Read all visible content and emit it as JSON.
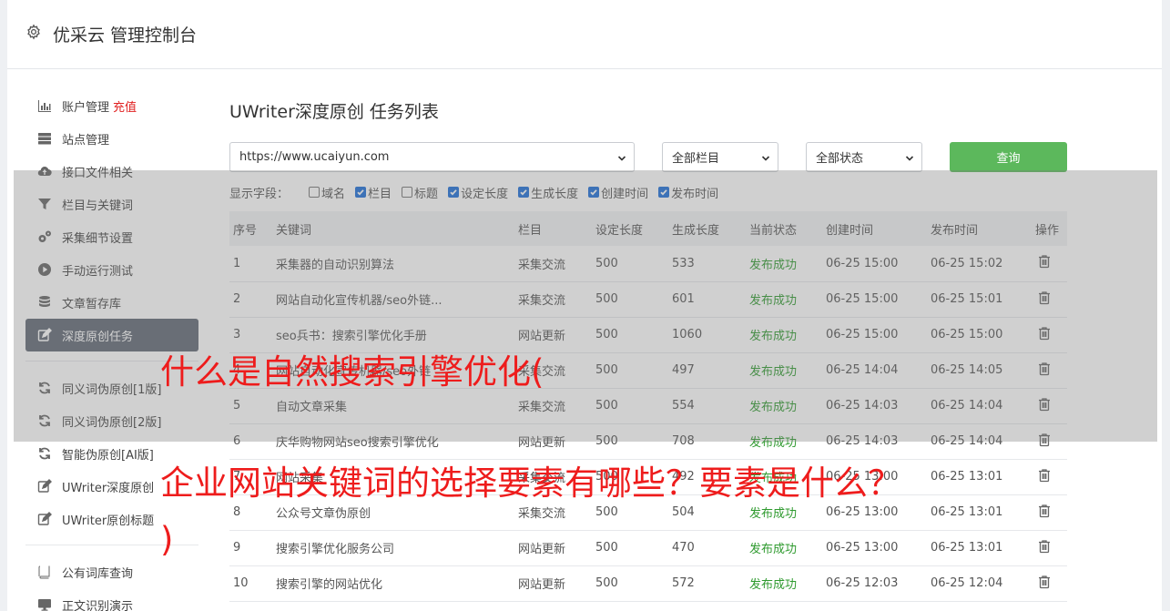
{
  "header": {
    "title": "优采云 管理控制台"
  },
  "sidebar": {
    "items": [
      {
        "label": "账户管理",
        "extra": "充值",
        "icon": "bar-chart-icon"
      },
      {
        "label": "站点管理",
        "icon": "server-icon"
      },
      {
        "label": "接口文件相关",
        "icon": "cloud-upload-icon"
      },
      {
        "label": "栏目与关键词",
        "icon": "filter-icon"
      },
      {
        "label": "采集细节设置",
        "icon": "gears-icon"
      },
      {
        "label": "手动运行测试",
        "icon": "play-circle-icon"
      },
      {
        "label": "文章暂存库",
        "icon": "database-icon"
      },
      {
        "label": "深度原创任务",
        "icon": "edit-icon",
        "active": true
      },
      {
        "label": "同义词伪原创[1版]",
        "icon": "refresh-icon"
      },
      {
        "label": "同义词伪原创[2版]",
        "icon": "refresh-icon"
      },
      {
        "label": "智能伪原创[AI版]",
        "icon": "refresh-icon"
      },
      {
        "label": "UWriter深度原创",
        "icon": "edit-icon"
      },
      {
        "label": "UWriter原创标题",
        "icon": "edit-icon"
      },
      {
        "label": "公有词库查询",
        "icon": "book-icon"
      },
      {
        "label": "正文识别演示",
        "icon": "monitor-icon"
      }
    ]
  },
  "main": {
    "title": "UWriter深度原创 任务列表",
    "site_select": "https://www.ucaiyun.com",
    "column_select": "全部栏目",
    "status_select": "全部状态",
    "query_label": "查询",
    "fields_label": "显示字段：",
    "fields": [
      {
        "label": "域名",
        "checked": false
      },
      {
        "label": "栏目",
        "checked": true
      },
      {
        "label": "标题",
        "checked": false
      },
      {
        "label": "设定长度",
        "checked": true
      },
      {
        "label": "生成长度",
        "checked": true
      },
      {
        "label": "创建时间",
        "checked": true
      },
      {
        "label": "发布时间",
        "checked": true
      }
    ],
    "table": {
      "headers": [
        "序号",
        "关键词",
        "栏目",
        "设定长度",
        "生成长度",
        "当前状态",
        "创建时间",
        "发布时间",
        "操作"
      ],
      "rows": [
        [
          "1",
          "采集器的自动识别算法",
          "采集交流",
          "500",
          "533",
          "发布成功",
          "06-25 15:00",
          "06-25 15:02"
        ],
        [
          "2",
          "网站自动化宣传机器/seo外链...",
          "采集交流",
          "500",
          "601",
          "发布成功",
          "06-25 15:00",
          "06-25 15:01"
        ],
        [
          "3",
          "seo兵书：搜索引擎优化手册",
          "网站更新",
          "500",
          "1060",
          "发布成功",
          "06-25 15:00",
          "06-25 15:00"
        ],
        [
          "4",
          "网站自动化宣传机器/seo外链",
          "采集交流",
          "500",
          "497",
          "发布成功",
          "06-25 14:04",
          "06-25 14:05"
        ],
        [
          "5",
          "自动文章采集",
          "采集交流",
          "500",
          "554",
          "发布成功",
          "06-25 14:03",
          "06-25 14:04"
        ],
        [
          "6",
          "庆华购物网站seo搜索引擎优化",
          "网站更新",
          "500",
          "708",
          "发布成功",
          "06-25 14:03",
          "06-25 14:04"
        ],
        [
          "7",
          "网站采集",
          "采集交流",
          "500",
          "492",
          "发布成功",
          "06-25 13:00",
          "06-25 13:01"
        ],
        [
          "8",
          "公众号文章伪原创",
          "采集交流",
          "500",
          "504",
          "发布成功",
          "06-25 13:00",
          "06-25 13:01"
        ],
        [
          "9",
          "搜索引擎优化服务公司",
          "网站更新",
          "500",
          "470",
          "发布成功",
          "06-25 13:00",
          "06-25 13:01"
        ],
        [
          "10",
          "搜索引擎的网站优化",
          "网站更新",
          "500",
          "572",
          "发布成功",
          "06-25 12:03",
          "06-25 12:04"
        ]
      ]
    }
  },
  "overlay": {
    "line1": "什么是自然搜索引擎优化(",
    "line2": "企业网站关键词的选择要素有哪些？要素是什么？",
    "line3": ")"
  }
}
